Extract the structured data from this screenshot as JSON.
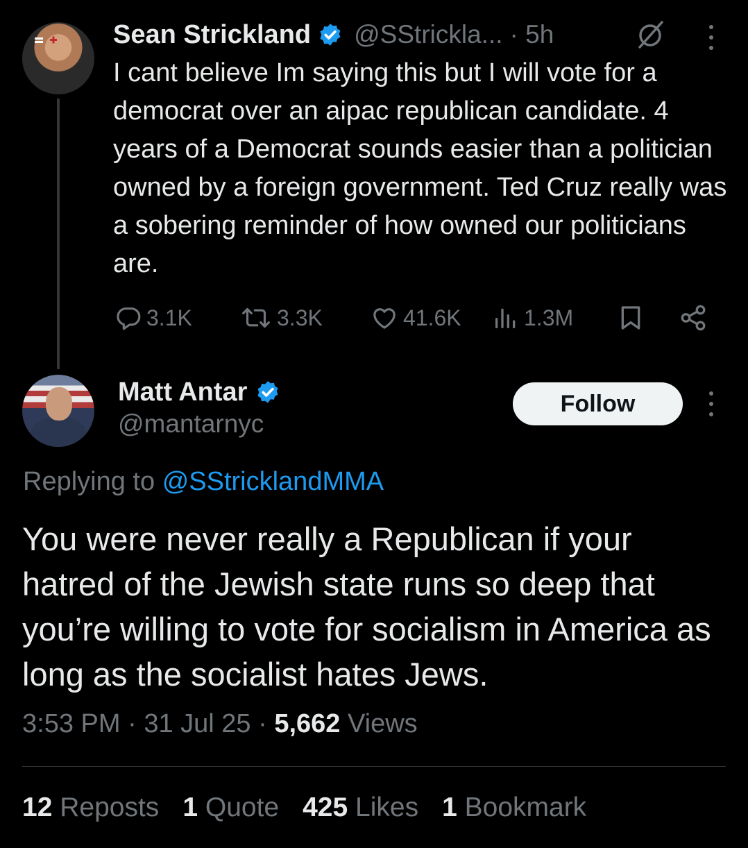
{
  "parent_tweet": {
    "name": "Sean Strickland",
    "handle": "@SStrickla...",
    "time": "· 5h",
    "text": "I cant believe Im saying this but I will vote for a democrat over an aipac republican candidate. 4 years of a Democrat sounds easier than a politician owned by a foreign government. Ted Cruz really was a sobering reminder of how owned our politicians are.",
    "replies": "3.1K",
    "reposts": "3.3K",
    "likes": "41.6K",
    "views": "1.3M"
  },
  "main_tweet": {
    "name": "Matt Antar",
    "handle": "@mantarnyc",
    "follow_label": "Follow",
    "replying_prefix": "Replying to",
    "replying_to": "@SStricklandMMA",
    "text": "You were never really a Republican if your hatred of the Jewish state runs so deep that you’re willing to vote for socialism in America as long as the socialist hates Jews.",
    "time": "3:53 PM",
    "date": "31 Jul 25",
    "views_count": "5,662",
    "views_label": "Views",
    "separator": "·"
  },
  "stats": {
    "reposts_count": "12",
    "reposts_label": "Reposts",
    "quotes_count": "1",
    "quotes_label": "Quote",
    "likes_count": "425",
    "likes_label": "Likes",
    "bookmarks_count": "1",
    "bookmarks_label": "Bookmark"
  },
  "icons": {
    "verified": "verified-badge-icon",
    "grok": "grok-icon",
    "more": "more-icon",
    "reply": "reply-icon",
    "repost": "repost-icon",
    "like": "heart-icon",
    "views": "views-icon",
    "bookmark": "bookmark-icon",
    "share": "share-icon"
  },
  "colors": {
    "background": "#000000",
    "text": "#e7e9ea",
    "secondary": "#71767b",
    "accent": "#1d9bf0",
    "follow_bg": "#eff3f4"
  }
}
